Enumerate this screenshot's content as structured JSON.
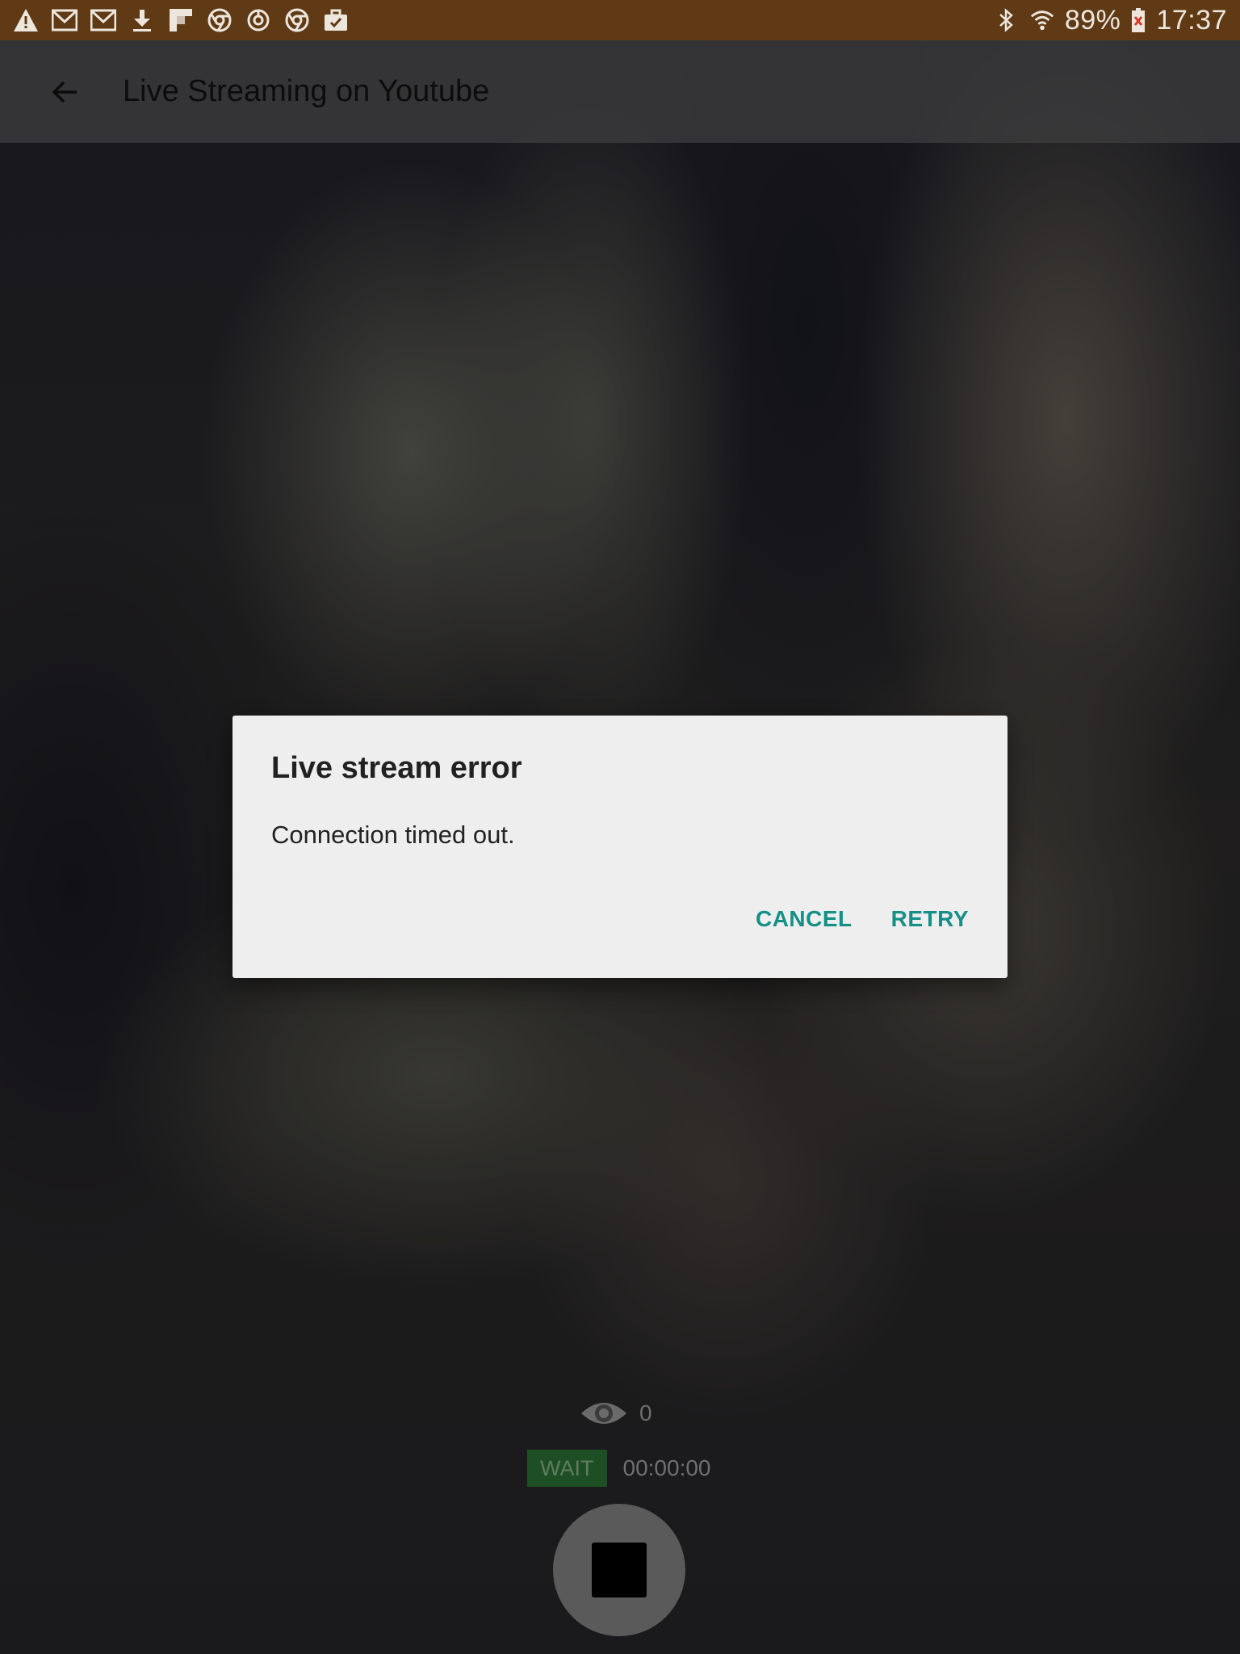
{
  "status_bar": {
    "left_icons": [
      "warning-icon",
      "gmail-icon",
      "gmail-icon",
      "download-icon",
      "flipboard-icon",
      "chrome-icon",
      "sync-icon",
      "chrome-icon",
      "briefcase-check-icon"
    ],
    "right_icons": [
      "bluetooth-icon",
      "wifi-icon",
      "battery-icon"
    ],
    "battery": "89%",
    "time": "17:37",
    "background_color": "#5f3a15"
  },
  "app_bar": {
    "title": "Live Streaming on Youtube",
    "back_icon": "back-arrow-icon"
  },
  "dialog": {
    "title": "Live stream error",
    "message": "Connection timed out.",
    "cancel_label": "CANCEL",
    "retry_label": "RETRY",
    "accent_color": "#149087"
  },
  "stream": {
    "viewer_icon": "eye-icon",
    "viewers": "0",
    "state_label": "WAIT",
    "timer": "00:00:00",
    "stop_icon": "stop-icon"
  }
}
